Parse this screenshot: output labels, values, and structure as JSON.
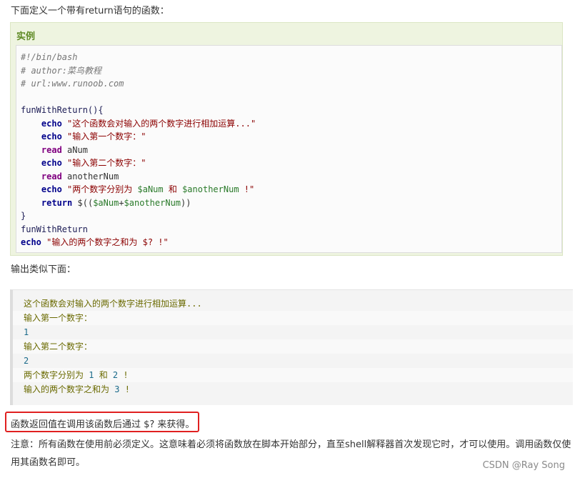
{
  "intro": "下面定义一个带有return语句的函数：",
  "example": {
    "title": "实例",
    "code": {
      "shebang": "#!/bin/bash",
      "author": "# author:菜鸟教程",
      "url": "# url:www.runoob.com",
      "func_open": "funWithReturn(){",
      "l1_cmd": "echo",
      "l1_str": "\"这个函数会对输入的两个数字进行相加运算...\"",
      "l2_cmd": "echo",
      "l2_str": "\"输入第一个数字：\"",
      "l3_cmd": "read",
      "l3_var": "aNum",
      "l4_cmd": "echo",
      "l4_str": "\"输入第二个数字：\"",
      "l5_cmd": "read",
      "l5_var": "anotherNum",
      "l6_cmd": "echo",
      "l6_a": "\"两个数字分别为 ",
      "l6_v1": "$aNum",
      "l6_b": " 和 ",
      "l6_v2": "$anotherNum",
      "l6_c": " !\"",
      "l7_cmd": "return",
      "l7_a": "$((",
      "l7_v1": "$aNum",
      "l7_plus": "+",
      "l7_v2": "$anotherNum",
      "l7_b": "))",
      "func_close": "}",
      "call": "funWithReturn",
      "final_cmd": "echo",
      "final_str": "\"输入的两个数字之和为 $? !\""
    }
  },
  "output_intro": "输出类似下面：",
  "output": {
    "line1": "这个函数会对输入的两个数字进行相加运算...",
    "line2": "输入第一个数字：",
    "line3": "1",
    "line4": "输入第二个数字：",
    "line5": "2",
    "line6_a": "两个数字分别为 ",
    "line6_n1": "1",
    "line6_b": " 和 ",
    "line6_n2": "2",
    "line6_c": " !",
    "line7_a": "输入的两个数字之和为 ",
    "line7_n": "3",
    "line7_b": " !"
  },
  "return_note": "函数返回值在调用该函数后通过 $? 来获得。",
  "note": "注意：所有函数在使用前必须定义。这意味着必须将函数放在脚本开始部分，直至shell解释器首次发现它时，才可以使用。调用函数仅使用其函数名即可。",
  "watermark": "CSDN @Ray Song",
  "colors": {
    "highlight_border": "#e02020",
    "example_title": "#5f8a25"
  }
}
